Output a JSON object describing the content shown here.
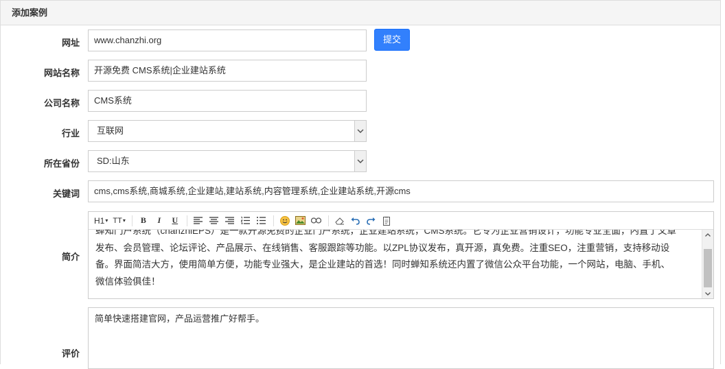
{
  "panel": {
    "title": "添加案例"
  },
  "form": {
    "url": {
      "label": "网址",
      "value": "www.chanzhi.org"
    },
    "submit_label": "提交",
    "site_name": {
      "label": "网站名称",
      "value": "开源免费 CMS系统|企业建站系统"
    },
    "company": {
      "label": "公司名称",
      "value": "CMS系统"
    },
    "industry": {
      "label": "行业",
      "value": "互联网"
    },
    "province": {
      "label": "所在省份",
      "value": "SD:山东"
    },
    "keywords": {
      "label": "关键词",
      "value": "cms,cms系统,商城系统,企业建站,建站系统,内容管理系统,企业建站系统,开源cms"
    },
    "summary": {
      "label": "简介",
      "toolbar": [
        "H1",
        "TT",
        "B",
        "I",
        "U"
      ],
      "lines": [
        "蝉知门户系统（chanzhiEPS）是一款开源免费的企业门户系统，企业建站系统，CMS系统。它专为企业营销设计，功能专业全面，内置了文章",
        "发布、会员管理、论坛评论、产品展示、在线销售、客服跟踪等功能。以ZPL协议发布，真开源，真免费。注重SEO，注重营销，支持移动设",
        "备。界面简洁大方，使用简单方便，功能专业强大，是企业建站的首选！同时蝉知系统还内置了微信公众平台功能，一个网站，电脑、手机、",
        "微信体验俱佳！"
      ]
    },
    "review": {
      "label": "评价",
      "value": "简单快速搭建官网，产品运营推广好帮手。"
    }
  },
  "colors": {
    "primary": "#3280fc",
    "border": "#cccccc",
    "heading_bg": "#f5f5f5"
  },
  "icons": [
    "chevron-down-icon",
    "align-left-icon",
    "align-center-icon",
    "align-right-icon",
    "ordered-list-icon",
    "unordered-list-icon",
    "emoji-icon",
    "image-icon",
    "link-icon",
    "eraser-icon",
    "undo-icon",
    "redo-icon",
    "paste-icon"
  ]
}
